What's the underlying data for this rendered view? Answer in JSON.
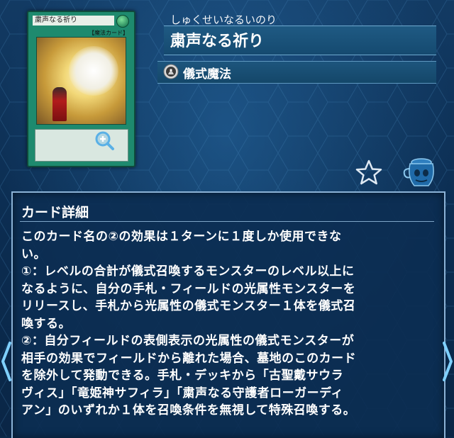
{
  "card": {
    "thumb_name": "粛声なる祈り",
    "thumb_type": "【魔法カード】",
    "reading": "しゅくせいなるいのり",
    "name": "粛声なる祈り",
    "card_type": "儀式魔法"
  },
  "details": {
    "title": "カード詳細",
    "lines": [
      "このカード名の②の効果は１ターンに１度しか使用できな",
      "い。",
      "①：レベルの合計が儀式召喚するモンスターのレベル以上に",
      "なるように、自分の手札・フィールドの光属性モンスターを",
      "リリースし、手札から光属性の儀式モンスター１体を儀式召",
      "喚する。",
      "②：自分フィールドの表側表示の光属性の儀式モンスターが",
      "相手の効果でフィールドから離れた場合、墓地のこのカード",
      "を除外して発動できる。手札・デッキから「古聖戴サウラ",
      "ヴィス」「竜姫神サフィラ」「粛声なる守護者ローガーディ",
      "アン」のいずれか１体を召喚条件を無視して特殊召喚する。"
    ]
  },
  "icons": {
    "zoom": "zoom-in-icon",
    "spell": "ritual-spell-icon",
    "favorite": "star-icon",
    "deck": "deck-pot-icon",
    "prev": "chevron-left-icon",
    "next": "chevron-right-icon"
  },
  "colors": {
    "spell_card": "#1e8a6e",
    "panel_border": "#8bb2d6",
    "background": "#0b2a4a"
  }
}
